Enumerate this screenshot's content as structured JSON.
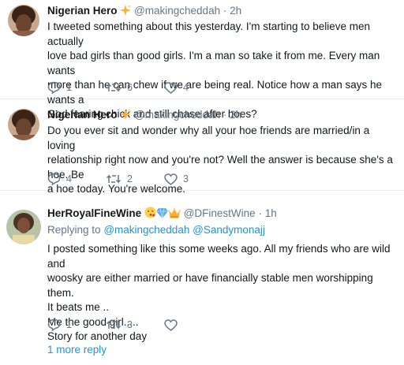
{
  "tweets": [
    {
      "name": "Nigerian Hero",
      "handle": "@makingcheddah",
      "separator": "·",
      "time": "2h",
      "lines": [
        "I tweeted something about this yesterday. I'm starting to believe men actually",
        "love bad girls than good girls. I'm a man so take it from me. Every man wants",
        "more than he can chew if we are being real. Notice how a man says he wants a",
        "God fearing chick and still chase after hoes?"
      ],
      "replies": "1",
      "retweets": "6",
      "likes": "4"
    },
    {
      "name": "Nigerian Hero",
      "handle": "@makingcheddah",
      "separator": "·",
      "time": "2h",
      "lines": [
        "Do you ever sit and wonder why all your hoe friends are married/in a loving",
        "relationship right now and you're not? Well the answer is because she's a hoe. Be",
        "a hoe today. You're welcome."
      ],
      "replies": "4",
      "retweets": "2",
      "likes": "3"
    },
    {
      "name": "HerRoyalFineWine",
      "handle": "@DFinestWine",
      "separator": "·",
      "time": "1h",
      "replying_label": "Replying to",
      "replying_to_1": "@makingcheddah",
      "replying_to_2": "@Sandymonajj",
      "lines": [
        "I posted something like this some weeks ago. All my friends who are wild and",
        "woosky are either married or have financially stable men worshipping them.",
        "It beats me ..",
        "Me the good girl.....",
        "Story for another day"
      ],
      "replies": "1",
      "retweets": "3",
      "likes": ""
    }
  ],
  "more_replies": "1 more reply",
  "colors": {
    "link": "#1b95e0",
    "muted": "#657786",
    "text": "#14171a",
    "divider": "#e6ecf0",
    "sparkle": "#ffac33"
  },
  "icons": [
    "sparkles-icon",
    "reply-icon",
    "retweet-icon",
    "like-icon",
    "face-blowing-kiss-icon",
    "gem-icon",
    "crown-icon"
  ]
}
